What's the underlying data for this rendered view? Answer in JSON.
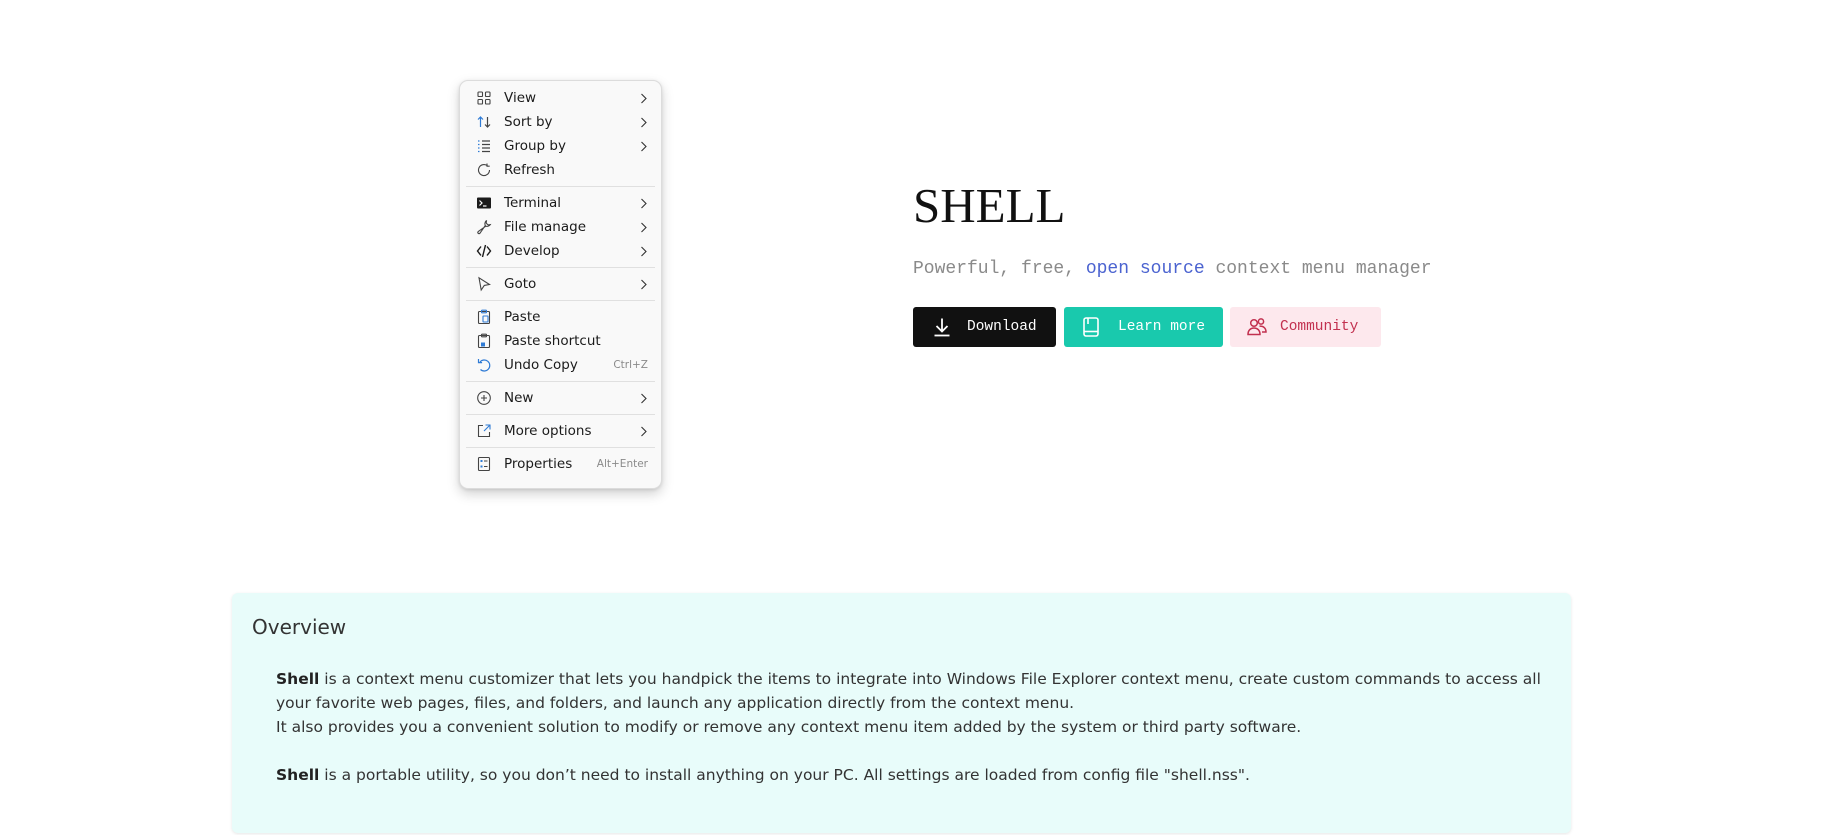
{
  "context_menu": {
    "items": [
      {
        "id": "view",
        "label": "View",
        "icon": "grid-icon",
        "submenu": true
      },
      {
        "id": "sort-by",
        "label": "Sort by",
        "icon": "sort-icon",
        "submenu": true
      },
      {
        "id": "group-by",
        "label": "Group by",
        "icon": "list-group-icon",
        "submenu": true
      },
      {
        "id": "refresh",
        "label": "Refresh",
        "icon": "refresh-icon",
        "submenu": false
      },
      {
        "id": "terminal",
        "label": "Terminal",
        "icon": "terminal-icon",
        "submenu": true
      },
      {
        "id": "file-manage",
        "label": "File manage",
        "icon": "wrench-icon",
        "submenu": true
      },
      {
        "id": "develop",
        "label": "Develop",
        "icon": "code-icon",
        "submenu": true
      },
      {
        "id": "goto",
        "label": "Goto",
        "icon": "pointer-icon",
        "submenu": true
      },
      {
        "id": "paste",
        "label": "Paste",
        "icon": "clipboard-icon",
        "submenu": false
      },
      {
        "id": "paste-shortcut",
        "label": "Paste shortcut",
        "icon": "clipboard-shortcut-icon",
        "submenu": false
      },
      {
        "id": "undo-copy",
        "label": "Undo Copy",
        "icon": "undo-icon",
        "submenu": false,
        "shortcut": "Ctrl+Z"
      },
      {
        "id": "new",
        "label": "New",
        "icon": "plus-circle-icon",
        "submenu": true
      },
      {
        "id": "more-options",
        "label": "More options",
        "icon": "external-window-icon",
        "submenu": true
      },
      {
        "id": "properties",
        "label": "Properties",
        "icon": "properties-icon",
        "submenu": false,
        "shortcut": "Alt+Enter"
      }
    ]
  },
  "hero": {
    "title": "SHELL",
    "subtitle_prefix": "Powerful, free, ",
    "subtitle_accent": "open source",
    "subtitle_suffix": " context menu manager",
    "buttons": {
      "download": "Download",
      "learn_more": "Learn more",
      "community": "Community"
    }
  },
  "overview": {
    "title": "Overview",
    "p1_strong": "Shell",
    "p1_text": " is a context menu customizer that lets you handpick the items to integrate into Windows File Explorer context menu, create custom commands to access all your favorite web pages, files, and folders, and launch any application directly from the context menu.",
    "p2_text": "It also provides you a convenient solution to modify or remove any context menu item added by the system or third party software.",
    "p3_strong": "Shell",
    "p3_text": " is a portable utility, so you don’t need to install anything on your PC. All settings are loaded from config file \"shell.nss\"."
  },
  "colors": {
    "accent_blue": "#4b63d0",
    "download_bg": "#111111",
    "learn_more_bg": "#19c9ad",
    "community_bg": "#fde8ed",
    "community_fg": "#c2304f",
    "overview_bg": "#e8fcfa"
  }
}
